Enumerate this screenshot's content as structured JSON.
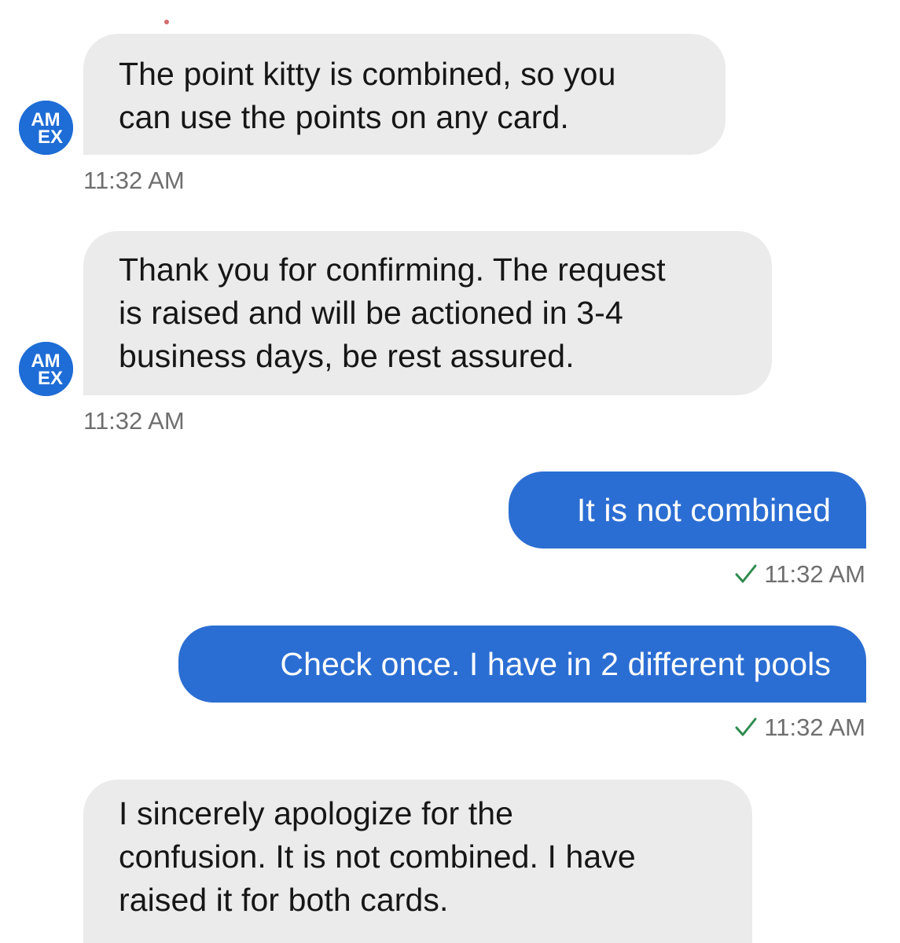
{
  "colors": {
    "incoming_bubble": "#ebebeb",
    "outgoing_bubble": "#2b6ed3",
    "avatar": "#1e6cd6",
    "read_check": "#2e8b4e",
    "timestamp": "#6f6f6f"
  },
  "avatar": {
    "line1": "AM",
    "line2": "EX"
  },
  "messages": [
    {
      "direction": "incoming",
      "lines": [
        "The point kitty is combined, so you",
        "can use the points on any card."
      ],
      "time": "11:32 AM"
    },
    {
      "direction": "incoming",
      "lines": [
        "Thank you for confirming. The request",
        "is raised and will be actioned in 3-4",
        "business days, be rest assured."
      ],
      "time": "11:32 AM"
    },
    {
      "direction": "outgoing",
      "lines": [
        "It is not combined"
      ],
      "time": "11:32 AM",
      "status_icon": "checkmark-icon"
    },
    {
      "direction": "outgoing",
      "lines": [
        "Check once. I have in 2 different pools"
      ],
      "time": "11:32 AM",
      "status_icon": "checkmark-icon"
    },
    {
      "direction": "incoming",
      "lines": [
        "I sincerely apologize for the",
        "confusion.  It is not combined. I have",
        "raised it for both cards."
      ]
    }
  ]
}
